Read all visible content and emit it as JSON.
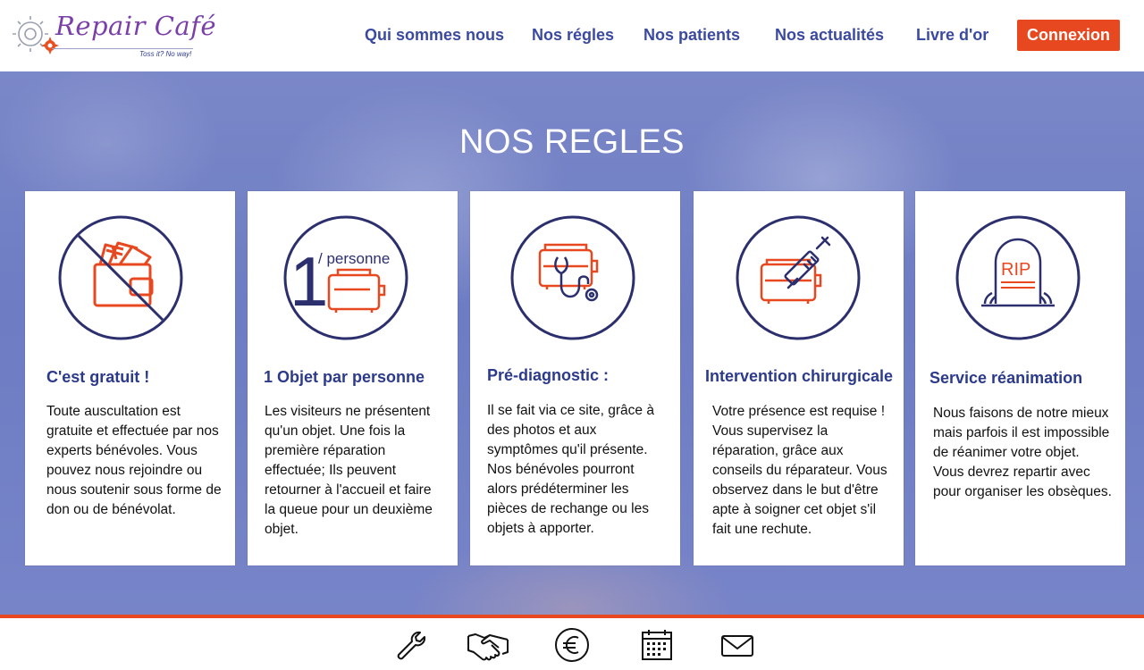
{
  "header": {
    "logo_text": "Repair Café",
    "logo_tagline": "Toss it? No way!",
    "nav": [
      {
        "label": "Qui sommes nous"
      },
      {
        "label": "Nos régles"
      },
      {
        "label": "Nos patients"
      },
      {
        "label": "Nos actualités"
      },
      {
        "label": "Livre d'or"
      }
    ],
    "login_label": "Connexion"
  },
  "hero": {
    "title": "NOS REGLES"
  },
  "cards": [
    {
      "icon": "no-money-icon",
      "title": "C'est gratuit !",
      "text": "Toute auscultation est gratuite et effectuée par nos experts bénévoles. Vous pouvez nous rejoindre ou nous soutenir sous forme de don ou de bénévolat."
    },
    {
      "icon": "one-per-person-icon",
      "icon_number": "1",
      "icon_text": "/ personne",
      "title": "1 Objet par personne",
      "text": "Les visiteurs ne présentent qu'un objet. Une fois la première réparation effectuée; Ils peuvent retourner à l'accueil et faire la queue pour un deuxième objet."
    },
    {
      "icon": "stethoscope-icon",
      "title": "Pré-diagnostic :",
      "text": "Il se fait via ce site, grâce à des photos et aux symptômes qu'il présente. Nos bénévoles pourront alors prédéterminer les pièces de rechange ou les objets à apporter."
    },
    {
      "icon": "syringe-icon",
      "title": "Intervention chirurgicale",
      "text": "Votre présence est requise ! Vous supervisez la réparation, grâce aux conseils du réparateur. Vous observez dans le but d'être apte à soigner cet objet s'il fait une rechute."
    },
    {
      "icon": "tombstone-icon",
      "icon_text": "RIP",
      "title": "Service réanimation",
      "text": "Nous faisons de notre mieux mais parfois il est impossible de réanimer votre objet. Vous devrez repartir avec pour organiser les obsèques."
    }
  ],
  "footer": {
    "icons": [
      "wrench-icon",
      "handshake-icon",
      "euro-icon",
      "calendar-icon",
      "mail-icon"
    ]
  },
  "colors": {
    "accent": "#e8481f",
    "navy": "#2c3a8c",
    "nav_text": "#3b4aa0",
    "hero_overlay": "#6d7cc3"
  }
}
